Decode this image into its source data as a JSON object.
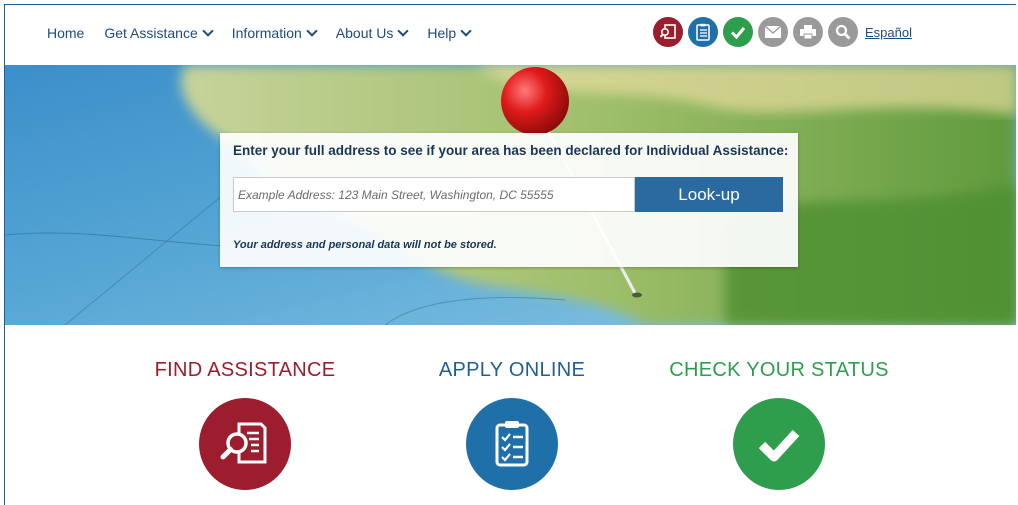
{
  "nav": {
    "items": [
      {
        "label": "Home",
        "has_dropdown": false
      },
      {
        "label": "Get Assistance",
        "has_dropdown": true
      },
      {
        "label": "Information",
        "has_dropdown": true
      },
      {
        "label": "About Us",
        "has_dropdown": true
      },
      {
        "label": "Help",
        "has_dropdown": true
      }
    ],
    "tools": [
      {
        "icon": "find-assistance-icon",
        "color": "#9b1d2e"
      },
      {
        "icon": "apply-online-icon",
        "color": "#1f6fa8"
      },
      {
        "icon": "check-status-icon",
        "color": "#2e9e4c"
      },
      {
        "icon": "email-icon",
        "color": "#9a9a9a"
      },
      {
        "icon": "print-icon",
        "color": "#9a9a9a"
      },
      {
        "icon": "search-icon",
        "color": "#9a9a9a"
      }
    ],
    "language_link": "Español"
  },
  "lookup": {
    "title": "Enter your full address to see if your area has been declared for Individual Assistance:",
    "placeholder": "Example Address: 123 Main Street, Washington, DC 55555",
    "button": "Look-up",
    "note": "Your address and personal data will not be stored."
  },
  "cards": [
    {
      "title": "FIND ASSISTANCE",
      "color": "#9b1d2e",
      "icon": "find-assistance-icon"
    },
    {
      "title": "APPLY ONLINE",
      "color": "#1f6fa8",
      "icon": "apply-online-icon"
    },
    {
      "title": "CHECK YOUR STATUS",
      "color": "#2e9e4c",
      "icon": "check-status-icon"
    }
  ]
}
